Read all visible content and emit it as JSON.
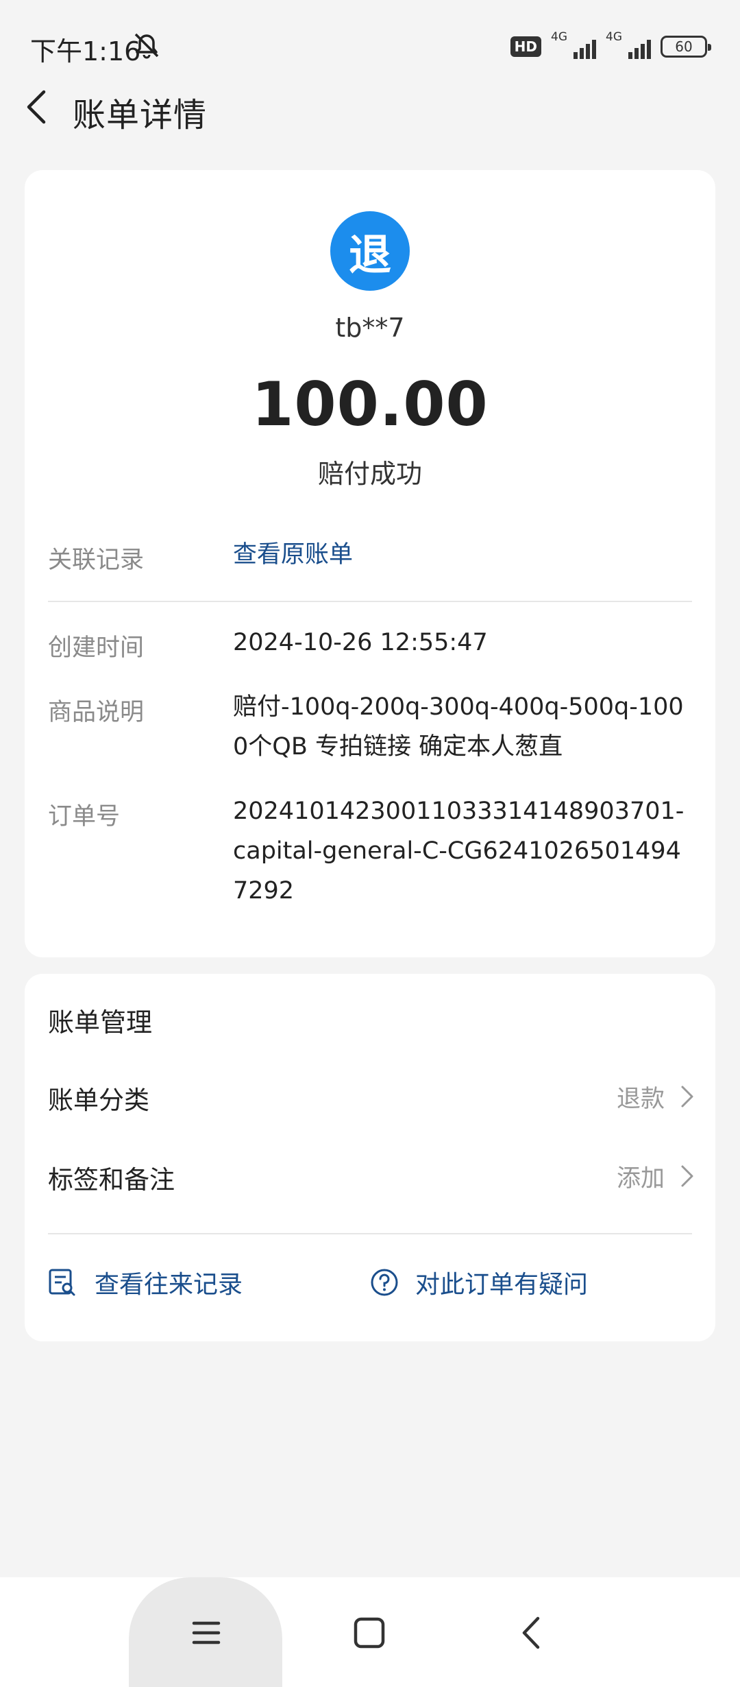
{
  "status_bar": {
    "time": "下午1:16",
    "hd_badge": "HD",
    "network_1": "4G",
    "network_2": "4G",
    "battery": "60"
  },
  "header": {
    "title": "账单详情"
  },
  "summary": {
    "badge_char": "退",
    "account": "tb**7",
    "amount": "100.00",
    "status": "赔付成功",
    "accent_color": "#1c8ded"
  },
  "details": {
    "related_label": "关联记录",
    "related_link": "查看原账单",
    "created_label": "创建时间",
    "created_value": "2024-10-26 12:55:47",
    "product_label": "商品说明",
    "product_value": "赔付-100q-200q-300q-400q-500q-1000个QB 专拍链接 确定本人葱直",
    "order_label": "订单号",
    "order_value": "20241014230011033314148903701-capital-general-C-CG62410265014947292"
  },
  "management": {
    "title": "账单管理",
    "category_label": "账单分类",
    "category_value": "退款",
    "tags_label": "标签和备注",
    "tags_value": "添加",
    "history_action": "查看往来记录",
    "question_action": "对此订单有疑问",
    "link_color": "#1a4e8c"
  },
  "nav_bar": {
    "icons": [
      "menu-icon",
      "home-icon",
      "back-icon"
    ]
  }
}
